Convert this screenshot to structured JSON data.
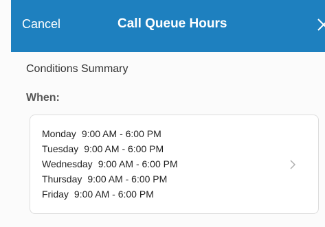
{
  "header": {
    "cancel_label": "Cancel",
    "title": "Call Queue Hours",
    "close_icon": "close-icon",
    "background_color": "#1e80bf"
  },
  "content": {
    "summary_label": "Conditions Summary",
    "when_label": "When:",
    "schedule": [
      {
        "day": "Monday",
        "hours": "9:00 AM - 6:00 PM"
      },
      {
        "day": "Tuesday",
        "hours": "9:00 AM - 6:00 PM"
      },
      {
        "day": "Wednesday",
        "hours": "9:00 AM - 6:00 PM"
      },
      {
        "day": "Thursday",
        "hours": "9:00 AM - 6:00 PM"
      },
      {
        "day": "Friday",
        "hours": "9:00 AM - 6:00 PM"
      }
    ],
    "chevron_icon": "chevron-right-icon"
  }
}
